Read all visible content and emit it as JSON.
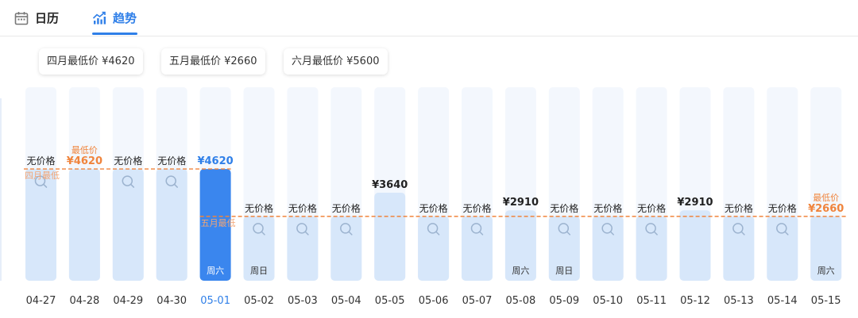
{
  "tabs": [
    {
      "label": "日历",
      "icon": "calendar-icon",
      "active": false
    },
    {
      "label": "趋势",
      "icon": "trend-chart-icon",
      "active": true
    }
  ],
  "month_lows": [
    {
      "label": "四月最低价 ¥4620"
    },
    {
      "label": "五月最低价 ¥2660"
    },
    {
      "label": "六月最低价 ¥5600"
    }
  ],
  "colors": {
    "accent": "#2f7fe8",
    "selected_bar": "#3a86ee",
    "bar": "#d7e7fa",
    "bar_bg": "#f3f7fd",
    "low_line": "#f0843c",
    "low_line_label": "#f3a574"
  },
  "chart_data": {
    "type": "bar",
    "categories": [
      "04-27",
      "04-28",
      "04-29",
      "04-30",
      "05-01",
      "05-02",
      "05-03",
      "05-04",
      "05-05",
      "05-06",
      "05-07",
      "05-08",
      "05-09",
      "05-10",
      "05-11",
      "05-12",
      "05-13",
      "05-14",
      "05-15"
    ],
    "values": [
      4620,
      4620,
      4620,
      4620,
      4620,
      2660,
      2660,
      2660,
      3640,
      2660,
      2660,
      2910,
      2660,
      2660,
      2660,
      2910,
      2660,
      2660,
      2660
    ],
    "price_labels": [
      "无价格",
      "¥4620",
      "无价格",
      "无价格",
      "¥4620",
      "无价格",
      "无价格",
      "无价格",
      "¥3640",
      "无价格",
      "无价格",
      "¥2910",
      "无价格",
      "无价格",
      "无价格",
      "¥2910",
      "无价格",
      "无价格",
      "¥2660"
    ],
    "has_price": [
      false,
      true,
      false,
      false,
      true,
      false,
      false,
      false,
      true,
      false,
      false,
      true,
      false,
      false,
      false,
      true,
      false,
      false,
      true
    ],
    "is_lowest": [
      false,
      true,
      false,
      false,
      false,
      false,
      false,
      false,
      false,
      false,
      false,
      false,
      false,
      false,
      false,
      false,
      false,
      false,
      true
    ],
    "lowest_tag": "最低价",
    "weekdays": [
      "",
      "",
      "",
      "",
      "周六",
      "周日",
      "",
      "",
      "",
      "",
      "",
      "周六",
      "周日",
      "",
      "",
      "",
      "",
      "",
      "周六"
    ],
    "selected_index": 4,
    "reference_lines": [
      {
        "label": "四月最低",
        "value": 4620,
        "from": 0,
        "to": 4
      },
      {
        "label": "五月最低",
        "value": 2660,
        "from": 4,
        "to": 18
      }
    ],
    "ylim": [
      0,
      8000
    ]
  }
}
